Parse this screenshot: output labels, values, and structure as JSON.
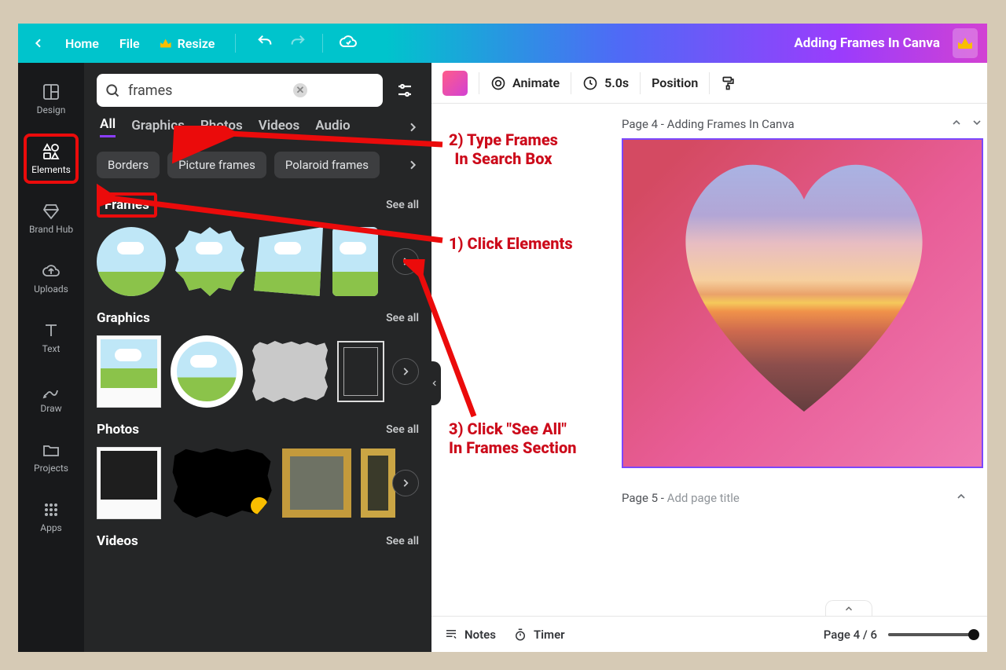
{
  "topbar": {
    "home": "Home",
    "file": "File",
    "resize": "Resize",
    "title": "Adding Frames In Canva"
  },
  "side_rail": {
    "items": [
      {
        "label": "Design"
      },
      {
        "label": "Elements"
      },
      {
        "label": "Brand Hub"
      },
      {
        "label": "Uploads"
      },
      {
        "label": "Text"
      },
      {
        "label": "Draw"
      },
      {
        "label": "Projects"
      },
      {
        "label": "Apps"
      }
    ]
  },
  "search": {
    "value": "frames"
  },
  "tabs": [
    "All",
    "Graphics",
    "Photos",
    "Videos",
    "Audio"
  ],
  "chips": [
    "Borders",
    "Picture frames",
    "Polaroid frames"
  ],
  "sections": {
    "frames": {
      "title": "Frames",
      "see_all": "See all"
    },
    "graphics": {
      "title": "Graphics",
      "see_all": "See all"
    },
    "photos": {
      "title": "Photos",
      "see_all": "See all"
    },
    "videos": {
      "title": "Videos",
      "see_all": "See all"
    }
  },
  "context_bar": {
    "animate": "Animate",
    "duration": "5.0s",
    "position": "Position"
  },
  "pages": {
    "page4_prefix": "Page 4 - ",
    "page4_title": "Adding Frames In Canva",
    "page5_prefix": "Page 5 - ",
    "page5_placeholder": "Add page title"
  },
  "bottom": {
    "notes": "Notes",
    "timer": "Timer",
    "page_ind": "Page 4 / 6"
  },
  "annotations": {
    "a1": "1) Click Elements",
    "a2_line1": "2) Type Frames",
    "a2_line2": "In Search Box",
    "a3_line1": "3) Click \"See All\"",
    "a3_line2": "In Frames Section"
  }
}
